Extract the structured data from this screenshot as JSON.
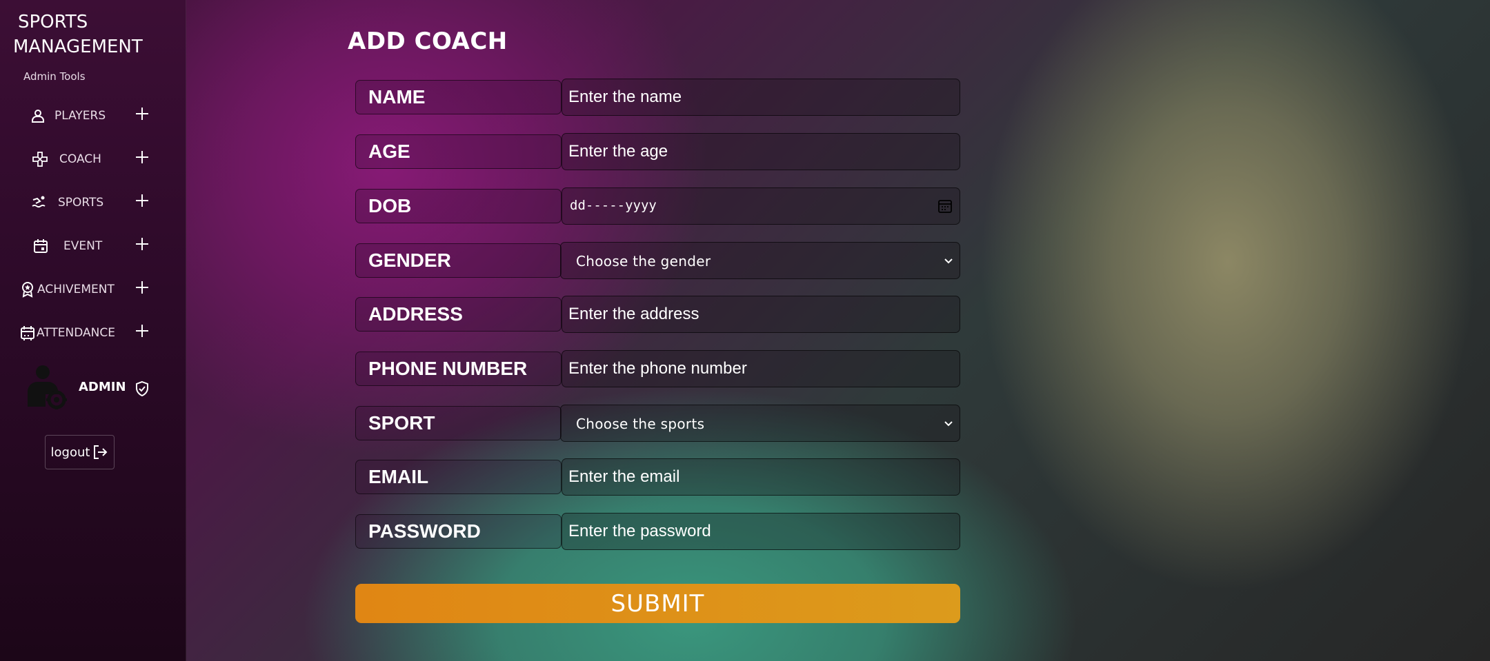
{
  "sidebar": {
    "brand_line1": "SPORTS",
    "brand_line2": "MANAGEMENT",
    "subtitle": "Admin Tools",
    "items": [
      {
        "label": "PLAYERS",
        "icon": "person-icon"
      },
      {
        "label": "COACH",
        "icon": "gamepad-icon"
      },
      {
        "label": "SPORTS",
        "icon": "swimmer-icon"
      },
      {
        "label": "EVENT",
        "icon": "calendar-icon"
      },
      {
        "label": "ACHIVEMENT",
        "icon": "award-icon"
      },
      {
        "label": "ATTENDANCE",
        "icon": "attendance-icon"
      }
    ],
    "admin_name": "ADMIN",
    "logout_label": "logout"
  },
  "main": {
    "title": "ADD COACH",
    "fields": {
      "name": {
        "label": "NAME",
        "placeholder": "Enter the name"
      },
      "age": {
        "label": "AGE",
        "placeholder": "Enter the age"
      },
      "dob": {
        "label": "DOB",
        "value": "dd-----yyyy"
      },
      "gender": {
        "label": "GENDER",
        "selected": "Choose the gender"
      },
      "address": {
        "label": "ADDRESS",
        "placeholder": "Enter the address"
      },
      "phone": {
        "label": "PHONE NUMBER",
        "placeholder": "Enter the phone number"
      },
      "sport": {
        "label": "SPORT",
        "selected": "Choose the sports"
      },
      "email": {
        "label": "EMAIL",
        "placeholder": "Enter the email"
      },
      "password": {
        "label": "PASSWORD",
        "placeholder": "Enter the password"
      }
    },
    "submit_label": "SUBMIT"
  },
  "colors": {
    "submit": "#e08614",
    "sidebar": "#2c0a28"
  }
}
